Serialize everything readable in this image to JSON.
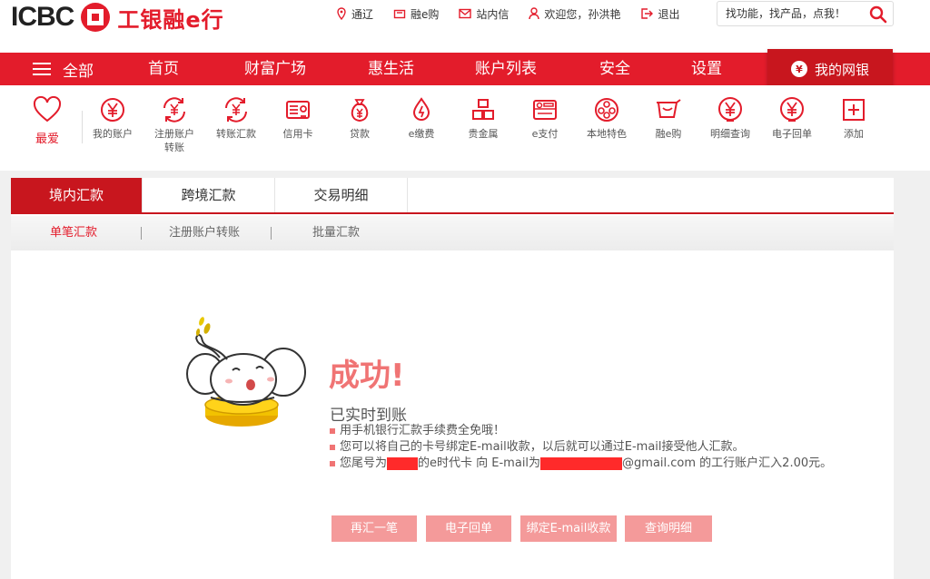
{
  "header": {
    "logo_text": "ICBC",
    "logo_cn": "工银融e行",
    "links": [
      {
        "icon": "location-icon",
        "label": "通辽"
      },
      {
        "icon": "cart-icon",
        "label": "融e购"
      },
      {
        "icon": "mail-icon",
        "label": "站内信"
      },
      {
        "icon": "user-icon",
        "label": "欢迎您，孙洪艳"
      },
      {
        "icon": "logout-icon",
        "label": "退出"
      }
    ],
    "search": {
      "placeholder": "找功能，找产品，点我！"
    }
  },
  "nav": {
    "all_label": "全部",
    "items": [
      "首页",
      "财富广场",
      "惠生活",
      "账户列表",
      "安全",
      "设置"
    ],
    "mybank_label": "我的网银"
  },
  "quick": {
    "favorite_label": "最爱",
    "items": [
      {
        "icon": "yen-icon",
        "label": "我的账户"
      },
      {
        "icon": "yen-exchange-icon",
        "label": "注册账户转账"
      },
      {
        "icon": "yen-exchange-icon",
        "label": "转账汇款"
      },
      {
        "icon": "card-icon",
        "label": "信用卡"
      },
      {
        "icon": "money-bag-icon",
        "label": "贷款"
      },
      {
        "icon": "water-drop-icon",
        "label": "e缴费"
      },
      {
        "icon": "gold-bars-icon",
        "label": "贵金属"
      },
      {
        "icon": "e-pay-icon",
        "label": "e支付"
      },
      {
        "icon": "local-feature-icon",
        "label": "本地特色"
      },
      {
        "icon": "shopping-cart-icon",
        "label": "融e购"
      },
      {
        "icon": "yen-icon",
        "label": "明细查询"
      },
      {
        "icon": "yen-icon",
        "label": "电子回单"
      },
      {
        "icon": "plus-icon",
        "label": "添加"
      }
    ]
  },
  "tabs": [
    "境内汇款",
    "跨境汇款",
    "交易明细"
  ],
  "subtabs": [
    "单笔汇款",
    "注册账户转账",
    "批量汇款"
  ],
  "result": {
    "title": "成功!",
    "subtitle": "已实时到账",
    "msg1": "用手机银行汇款手续费全免哦！",
    "msg2": "您可以将自己的卡号绑定E-mail收款，以后就可以通过E-mail接受他人汇款。",
    "msg3_a": "您尾号为",
    "msg3_b": "的e时代卡 向 E-mail为",
    "msg3_c": "@gmail.com 的工行账户汇入2.00元。"
  },
  "actions": [
    "再汇一笔",
    "电子回单",
    "绑定E-mail收款",
    "查询明细"
  ],
  "colors": {
    "brand_red": "#e31c2b",
    "dark_red": "#c8161e",
    "pink_button": "#f49a9a",
    "success_text": "#f07474"
  }
}
